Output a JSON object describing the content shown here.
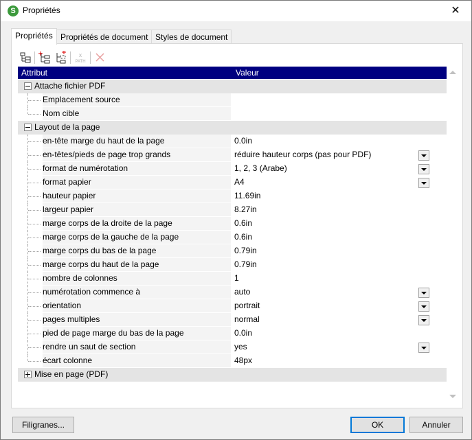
{
  "window": {
    "title": "Propriétés",
    "icon": "app-icon",
    "app_icon_glyph": "S"
  },
  "tabs": [
    {
      "label": "Propriétés",
      "active": true
    },
    {
      "label": "Propriétés de document",
      "active": false
    },
    {
      "label": "Styles de document",
      "active": false
    }
  ],
  "toolbar": {
    "buttons": [
      {
        "name": "tree-view-icon",
        "enabled": true
      },
      {
        "name": "add-node-icon",
        "enabled": true
      },
      {
        "name": "add-child-node-icon",
        "enabled": true
      },
      {
        "name": "xpath-icon",
        "enabled": false
      },
      {
        "name": "delete-icon",
        "enabled": false
      }
    ],
    "xpath_glyph": "PATH"
  },
  "grid": {
    "header": {
      "attribute": "Attribut",
      "value": "Valeur"
    },
    "groups": [
      {
        "label": "Attache fichier PDF",
        "expanded": true,
        "rows": [
          {
            "attr": "Emplacement source",
            "value": "",
            "dropdown": false
          },
          {
            "attr": "Nom cible",
            "value": "",
            "dropdown": false
          }
        ]
      },
      {
        "label": "Layout de la page",
        "expanded": true,
        "rows": [
          {
            "attr": "en-tête marge du haut de la page",
            "value": "0.0in",
            "dropdown": false
          },
          {
            "attr": "en-têtes/pieds de page trop grands",
            "value": "réduire hauteur corps (pas pour PDF)",
            "dropdown": true
          },
          {
            "attr": "format de numérotation",
            "value": "1, 2, 3 (Arabe)",
            "dropdown": true
          },
          {
            "attr": "format papier",
            "value": "A4",
            "dropdown": true
          },
          {
            "attr": "hauteur papier",
            "value": "11.69in",
            "dropdown": false
          },
          {
            "attr": "largeur papier",
            "value": "8.27in",
            "dropdown": false
          },
          {
            "attr": "marge corps de la droite de la page",
            "value": "0.6in",
            "dropdown": false
          },
          {
            "attr": "marge corps de la gauche de la page",
            "value": "0.6in",
            "dropdown": false
          },
          {
            "attr": "marge corps du bas de la page",
            "value": "0.79in",
            "dropdown": false
          },
          {
            "attr": "marge corps du haut de la page",
            "value": "0.79in",
            "dropdown": false
          },
          {
            "attr": "nombre de colonnes",
            "value": "1",
            "dropdown": false
          },
          {
            "attr": "numérotation commence à",
            "value": "auto",
            "dropdown": true
          },
          {
            "attr": "orientation",
            "value": "portrait",
            "dropdown": true
          },
          {
            "attr": "pages multiples",
            "value": "normal",
            "dropdown": true
          },
          {
            "attr": "pied de page marge du bas de la page",
            "value": "0.0in",
            "dropdown": false
          },
          {
            "attr": "rendre un saut de section",
            "value": "yes",
            "dropdown": true
          },
          {
            "attr": "écart colonne",
            "value": "48px",
            "dropdown": false
          }
        ]
      },
      {
        "label": "Mise en page (PDF)",
        "expanded": false,
        "rows": []
      }
    ]
  },
  "buttons": {
    "watermarks": "Filigranes...",
    "ok": "OK",
    "cancel": "Annuler"
  },
  "colors": {
    "header_bg": "#000080",
    "group_bg": "#e4e4e4",
    "default_button_border": "#0078d7"
  }
}
